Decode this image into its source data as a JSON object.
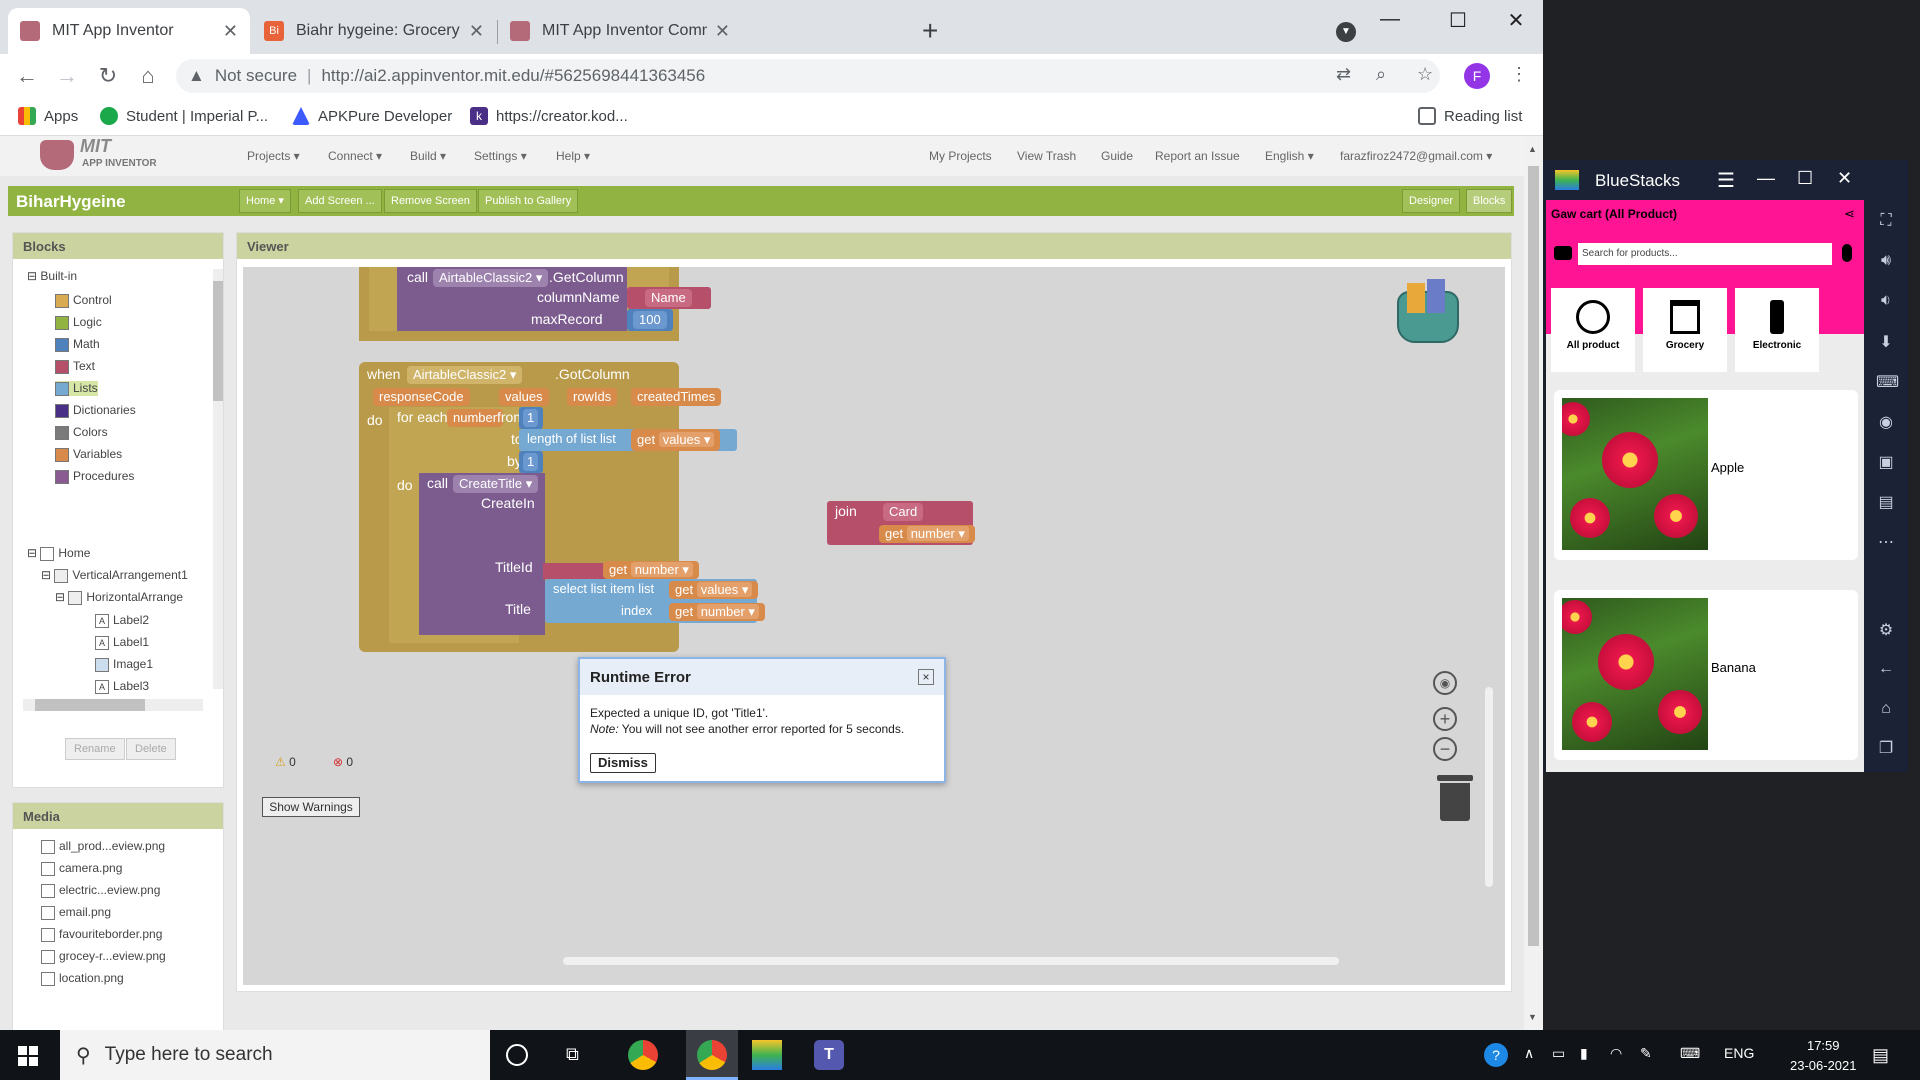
{
  "browser": {
    "tabs": [
      {
        "title": "MIT App Inventor",
        "active": true
      },
      {
        "title": "Biahr hygeine: Grocery - Airtable",
        "active": false
      },
      {
        "title": "MIT App Inventor Community",
        "active": false
      }
    ],
    "address": {
      "security": "Not secure",
      "url": "http://ai2.appinventor.mit.edu/#5625698441363456"
    },
    "profile_initial": "F",
    "bookmarks": [
      "Apps",
      "Student | Imperial P...",
      "APKPure Developer",
      "https://creator.kod..."
    ],
    "reading_list": "Reading list"
  },
  "appinventor": {
    "logo": {
      "mit": "MIT",
      "sub": "APP INVENTOR"
    },
    "menu_left": [
      "Projects ▾",
      "Connect ▾",
      "Build ▾",
      "Settings ▾",
      "Help ▾"
    ],
    "menu_right": [
      "My Projects",
      "View Trash",
      "Guide",
      "Report an Issue",
      "English ▾",
      "farazfiroz2472@gmail.com ▾"
    ],
    "project_name": "BiharHygeine",
    "project_buttons": [
      "Home ▾",
      "Add Screen ...",
      "Remove Screen",
      "Publish to Gallery"
    ],
    "mode_buttons": [
      "Designer",
      "Blocks"
    ],
    "blocks_panel": {
      "title": "Blocks",
      "builtin": "Built-in",
      "builtin_items": [
        {
          "label": "Control",
          "color": "#d8ab52"
        },
        {
          "label": "Logic",
          "color": "#90b342"
        },
        {
          "label": "Math",
          "color": "#4f81bd"
        },
        {
          "label": "Text",
          "color": "#b6506a"
        },
        {
          "label": "Lists",
          "color": "#76a9d2"
        },
        {
          "label": "Dictionaries",
          "color": "#4a2f86"
        },
        {
          "label": "Colors",
          "color": "#7a7a7a"
        },
        {
          "label": "Variables",
          "color": "#d88a4a"
        },
        {
          "label": "Procedures",
          "color": "#8a5a92"
        }
      ],
      "components": [
        "Home",
        "VerticalArrangement1",
        "HorizontalArrange",
        "Label2",
        "Label1",
        "Image1",
        "Label3"
      ],
      "rename": "Rename",
      "delete": "Delete"
    },
    "media_panel": {
      "title": "Media",
      "files": [
        "all_prod...eview.png",
        "camera.png",
        "electric...eview.png",
        "email.png",
        "favouriteborder.png",
        "grocey-r...eview.png",
        "location.png"
      ]
    },
    "viewer": {
      "title": "Viewer",
      "warnings_count": "0",
      "errors_count": "0",
      "show_warnings": "Show Warnings",
      "blocks": {
        "call1": "call",
        "comp1": "AirtableClassic2 ▾",
        "method1": ".GetColumn",
        "colname": "columnName",
        "colname_val": "Name",
        "maxrec": "maxRecord",
        "maxrec_val": "100",
        "when": "when",
        "event_comp": "AirtableClassic2 ▾",
        "event_name": ".GotColumn",
        "params": [
          "responseCode",
          "values",
          "rowIds",
          "createdTimes"
        ],
        "do1": "do",
        "foreach": "for each",
        "var": "number",
        "from": "from",
        "from_val": "1",
        "to": "to",
        "lengthof": "length of list  list",
        "get": "get",
        "values": "values ▾",
        "by": "by",
        "by_val": "1",
        "do2": "do",
        "call2": "call",
        "proc": "CreateTitle ▾",
        "createin": "CreateIn",
        "join": "join",
        "card": "Card",
        "number": "number ▾",
        "titleid": "TitleId",
        "title": "Title",
        "selectlist": "select list item  list",
        "index": "index"
      }
    },
    "dialog": {
      "title": "Runtime Error",
      "close": "×",
      "message": "Expected a unique ID, got 'Title1'.",
      "note_label": "Note:",
      "note": " You will not see another error reported for 5 seconds.",
      "button": "Dismiss"
    }
  },
  "bluestacks": {
    "title": "BlueStacks",
    "app_title": "Gaw cart (All Product)",
    "search_placeholder": "Search for products...",
    "categories": [
      "All product",
      "Grocery",
      "Electronic"
    ],
    "products": [
      "Apple",
      "Banana"
    ]
  },
  "taskbar": {
    "search_placeholder": "Type here to search",
    "language": "ENG",
    "time": "17:59",
    "date": "23-06-2021"
  }
}
